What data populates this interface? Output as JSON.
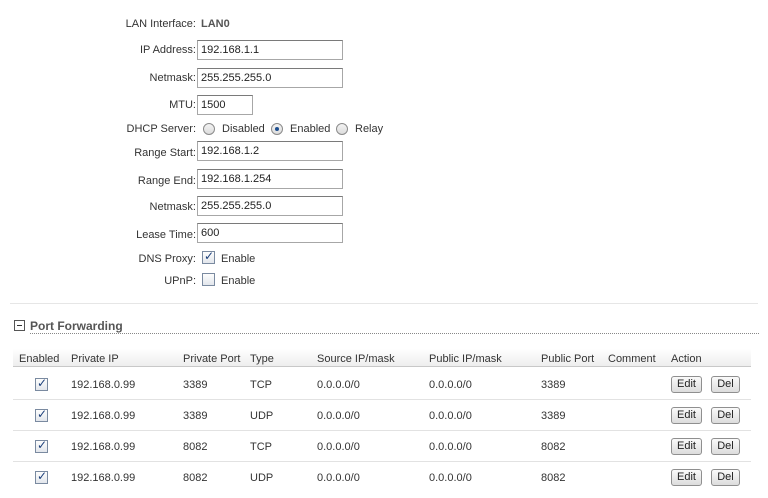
{
  "lan": {
    "interface_label": "LAN Interface:",
    "interface_value": "LAN0",
    "ip_label": "IP Address:",
    "ip_value": "192.168.1.1",
    "netmask_label": "Netmask:",
    "netmask_value": "255.255.255.0",
    "mtu_label": "MTU:",
    "mtu_value": "1500",
    "dhcp_label": "DHCP Server:",
    "dhcp_options": [
      "Disabled",
      "Enabled",
      "Relay"
    ],
    "dhcp_selected": "Enabled",
    "range_start_label": "Range Start:",
    "range_start_value": "192.168.1.2",
    "range_end_label": "Range End:",
    "range_end_value": "192.168.1.254",
    "dhcp_netmask_label": "Netmask:",
    "dhcp_netmask_value": "255.255.255.0",
    "lease_label": "Lease Time:",
    "lease_value": "600",
    "dns_proxy_label": "DNS Proxy:",
    "dns_proxy_enable": "Enable",
    "dns_proxy_checked": true,
    "upnp_label": "UPnP:",
    "upnp_enable": "Enable",
    "upnp_checked": false
  },
  "port_forwarding": {
    "title": "Port Forwarding",
    "columns": [
      "Enabled",
      "Private IP",
      "Private Port",
      "Type",
      "Source IP/mask",
      "Public IP/mask",
      "Public Port",
      "Comment",
      "Action"
    ],
    "edit_label": "Edit",
    "del_label": "Del",
    "rows": [
      {
        "enabled": true,
        "private_ip": "192.168.0.99",
        "private_port": "3389",
        "type": "TCP",
        "source": "0.0.0.0/0",
        "public_ip": "0.0.0.0/0",
        "public_port": "3389",
        "comment": ""
      },
      {
        "enabled": true,
        "private_ip": "192.168.0.99",
        "private_port": "3389",
        "type": "UDP",
        "source": "0.0.0.0/0",
        "public_ip": "0.0.0.0/0",
        "public_port": "3389",
        "comment": ""
      },
      {
        "enabled": true,
        "private_ip": "192.168.0.99",
        "private_port": "8082",
        "type": "TCP",
        "source": "0.0.0.0/0",
        "public_ip": "0.0.0.0/0",
        "public_port": "8082",
        "comment": ""
      },
      {
        "enabled": true,
        "private_ip": "192.168.0.99",
        "private_port": "8082",
        "type": "UDP",
        "source": "0.0.0.0/0",
        "public_ip": "0.0.0.0/0",
        "public_port": "8082",
        "comment": ""
      }
    ]
  }
}
